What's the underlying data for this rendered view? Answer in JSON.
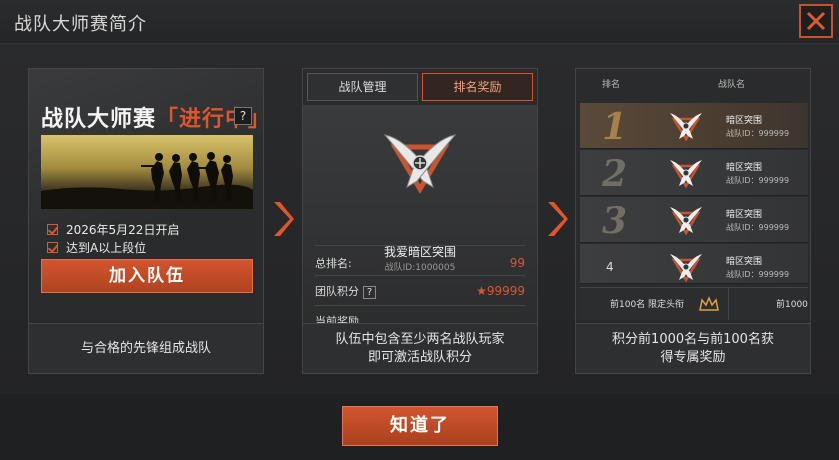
{
  "header": {
    "title": "战队大师赛简介"
  },
  "colors": {
    "accent": "#d2552e",
    "gold": "#e0a040"
  },
  "card1": {
    "headline": "战队大师赛",
    "headline_highlight": "「进行中」",
    "help": "?",
    "conditions": [
      "2026年5月22日开启",
      "达到A以上段位"
    ],
    "join_button": "加入队伍",
    "caption": "与合格的先锋组成战队"
  },
  "card2": {
    "tabs": [
      {
        "label": "战队管理",
        "active": false
      },
      {
        "label": "排名奖励",
        "active": true
      }
    ],
    "team_name": "我爱暗区突围",
    "team_id": "战队ID:1000005",
    "rank_label": "总排名:",
    "rank_value": "99",
    "points_label": "团队积分",
    "points_help": "?",
    "points_value": "★99999",
    "reward_label": "当前奖励",
    "caption_line1": "队伍中包含至少两名战队玩家",
    "caption_line2": "即可激活战队积分"
  },
  "card3": {
    "header_rank": "排名",
    "header_team": "战队名",
    "rows": [
      {
        "rank": "1",
        "name": "暗区突围",
        "id": "战队ID：999999"
      },
      {
        "rank": "2",
        "name": "暗区突围",
        "id": "战队ID：999999"
      },
      {
        "rank": "3",
        "name": "暗区突围",
        "id": "战队ID：999999"
      },
      {
        "rank": "4",
        "name": "暗区突围",
        "id": "战队ID：999999"
      }
    ],
    "top100_text": "前100名 限定头衔",
    "top1000_text": "前1000",
    "caption_line1": "积分前1000名与前100名获",
    "caption_line2": "得专属奖励"
  },
  "footer": {
    "confirm_button": "知道了"
  },
  "icons": [
    "close-icon",
    "help-icon",
    "checkbox-icon",
    "team-emblem-icon",
    "star-icon",
    "crown-icon",
    "arrow-right-icon"
  ]
}
